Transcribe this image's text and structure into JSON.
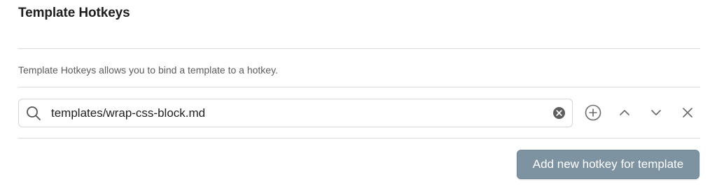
{
  "section": {
    "title": "Template Hotkeys",
    "description": "Template Hotkeys allows you to bind a template to a hotkey."
  },
  "hotkey_row": {
    "search_value": "templates/wrap-css-block.md",
    "icons": {
      "search": "search-icon",
      "clear": "clear-circle-icon",
      "add": "plus-circle-icon",
      "move_up": "chevron-up-icon",
      "move_down": "chevron-down-icon",
      "remove": "close-icon"
    }
  },
  "actions": {
    "add_hotkey_label": "Add new hotkey for template"
  },
  "colors": {
    "button_bg": "#7e93a2",
    "divider": "#dadada",
    "icon": "#6b6b6b"
  }
}
